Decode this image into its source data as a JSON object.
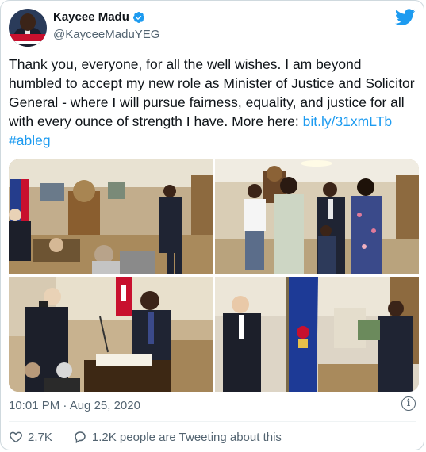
{
  "author": {
    "name": "Kaycee Madu",
    "handle": "@KayceeMaduYEG",
    "avatar_icon": "profile-avatar"
  },
  "tweet": {
    "text": "Thank you, everyone, for all the well wishes. I am beyond humbled to accept my new role as Minister of Justice and Solicitor General - where I will pursue fairness, equality, and justice for all with every ounce of strength I have. More here: ",
    "link": "bit.ly/31xmLTb",
    "hashtag": "#ableg"
  },
  "photos": [
    "photo-1",
    "photo-2",
    "photo-3",
    "photo-4"
  ],
  "meta": {
    "timestamp": "10:01 PM · Aug 25, 2020"
  },
  "actions": {
    "likes": "2.7K",
    "replies_text": "1.2K people are Tweeting about this"
  },
  "colors": {
    "link": "#1d9bf0",
    "secondary": "#536471",
    "like_red": "#e0245e"
  }
}
